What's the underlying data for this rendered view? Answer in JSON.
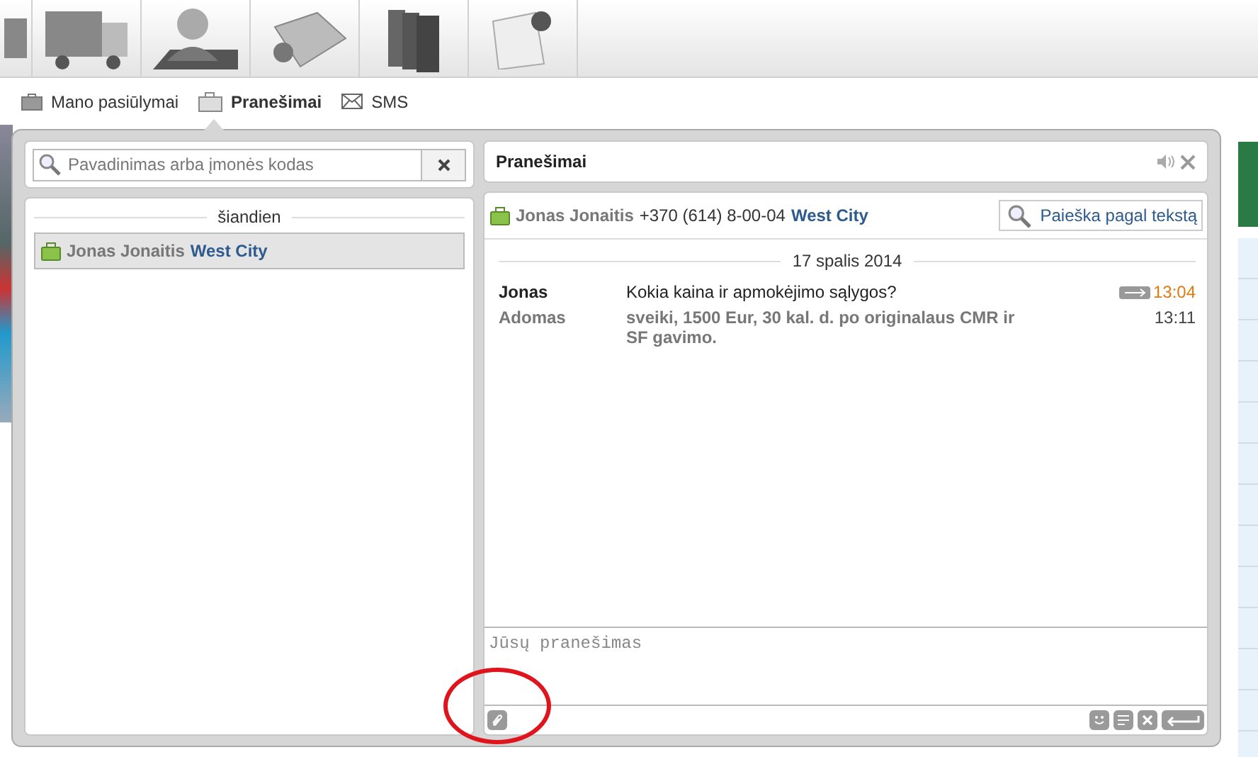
{
  "subnav": [
    {
      "label": "Mano pasiūlymai",
      "selected": false,
      "kind": "briefcase"
    },
    {
      "label": "Pranešimai",
      "selected": true,
      "kind": "messages"
    },
    {
      "label": "SMS",
      "selected": false,
      "kind": "envelope"
    }
  ],
  "contacts": {
    "search": {
      "placeholder": "Pavadinimas arba įmonės kodas"
    },
    "groups": [
      {
        "heading": "šiandien",
        "items": [
          {
            "name": "Jonas Jonaitis",
            "company": "West City",
            "selected": true
          }
        ]
      }
    ]
  },
  "chat": {
    "title": "Pranešimai",
    "contact": {
      "name": "Jonas Jonaitis",
      "phone": "+370 (614) 8-00-04",
      "company": "West City"
    },
    "search_button": "Paieška pagal tekstą",
    "date": "17 spalis 2014",
    "messages": [
      {
        "sender": "Jonas",
        "text": "Kokia kaina ir apmokėjimo sąlygos?",
        "time": "13:04",
        "kind": "incoming",
        "unread": true
      },
      {
        "sender": "Adomas",
        "text": "sveiki, 1500 Eur, 30 kal. d. po originalaus CMR ir SF gavimo.",
        "time": "13:11",
        "kind": "outgoing",
        "unread": false
      }
    ],
    "composer": {
      "placeholder": "Jūsų pranešimas"
    }
  }
}
